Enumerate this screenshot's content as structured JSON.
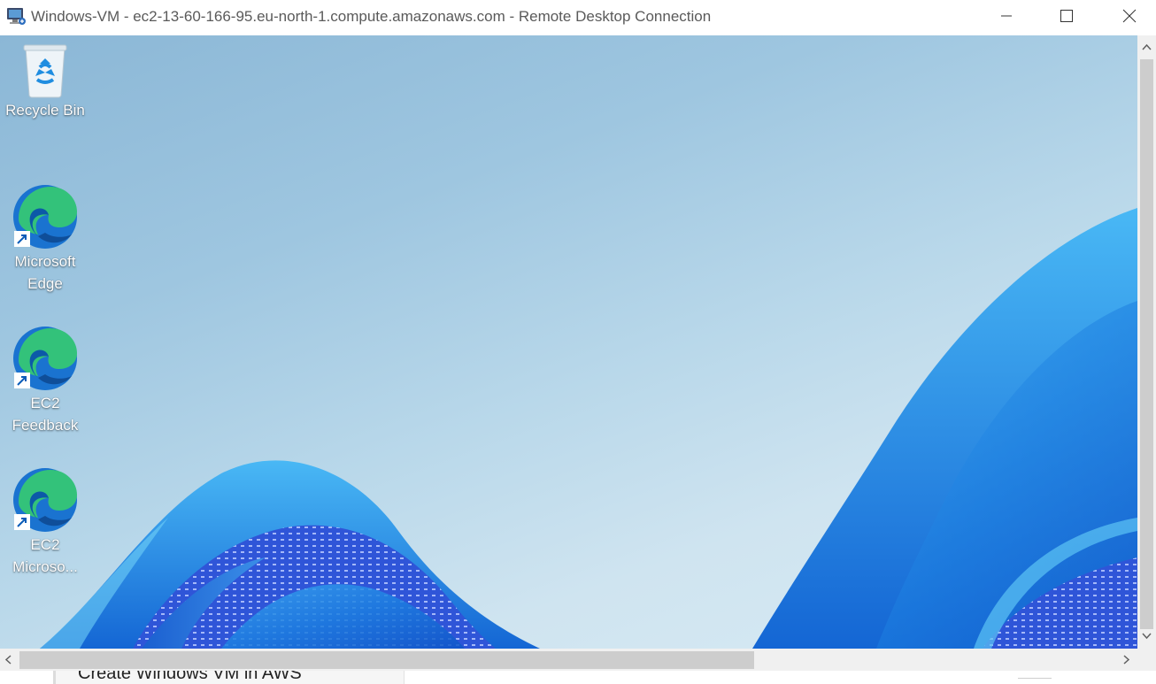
{
  "window": {
    "title": "Windows-VM - ec2-13-60-166-95.eu-north-1.compute.amazonaws.com - Remote Desktop Connection",
    "icon": "remote-desktop-icon",
    "controls": [
      "minimize-icon",
      "maximize-icon",
      "close-icon"
    ]
  },
  "desktop": {
    "icons": [
      {
        "line1": "Recycle Bin",
        "line2": "",
        "icon": "recycle-bin-icon"
      },
      {
        "line1": "Microsoft",
        "line2": "Edge",
        "icon": "edge-icon"
      },
      {
        "line1": "EC2",
        "line2": "Feedback",
        "icon": "edge-icon"
      },
      {
        "line1": "EC2",
        "line2": "Microso...",
        "icon": "edge-icon"
      }
    ]
  },
  "background_window": {
    "text": "Create Windows VM in AWS"
  },
  "colors": {
    "desktop_sky": "#9ec6e0",
    "bloom_blue": "#1a6fd6",
    "titlebar": "#ffffff",
    "scrollbar_track": "#f0f0f0",
    "scrollbar_thumb": "#cdcdcd"
  }
}
